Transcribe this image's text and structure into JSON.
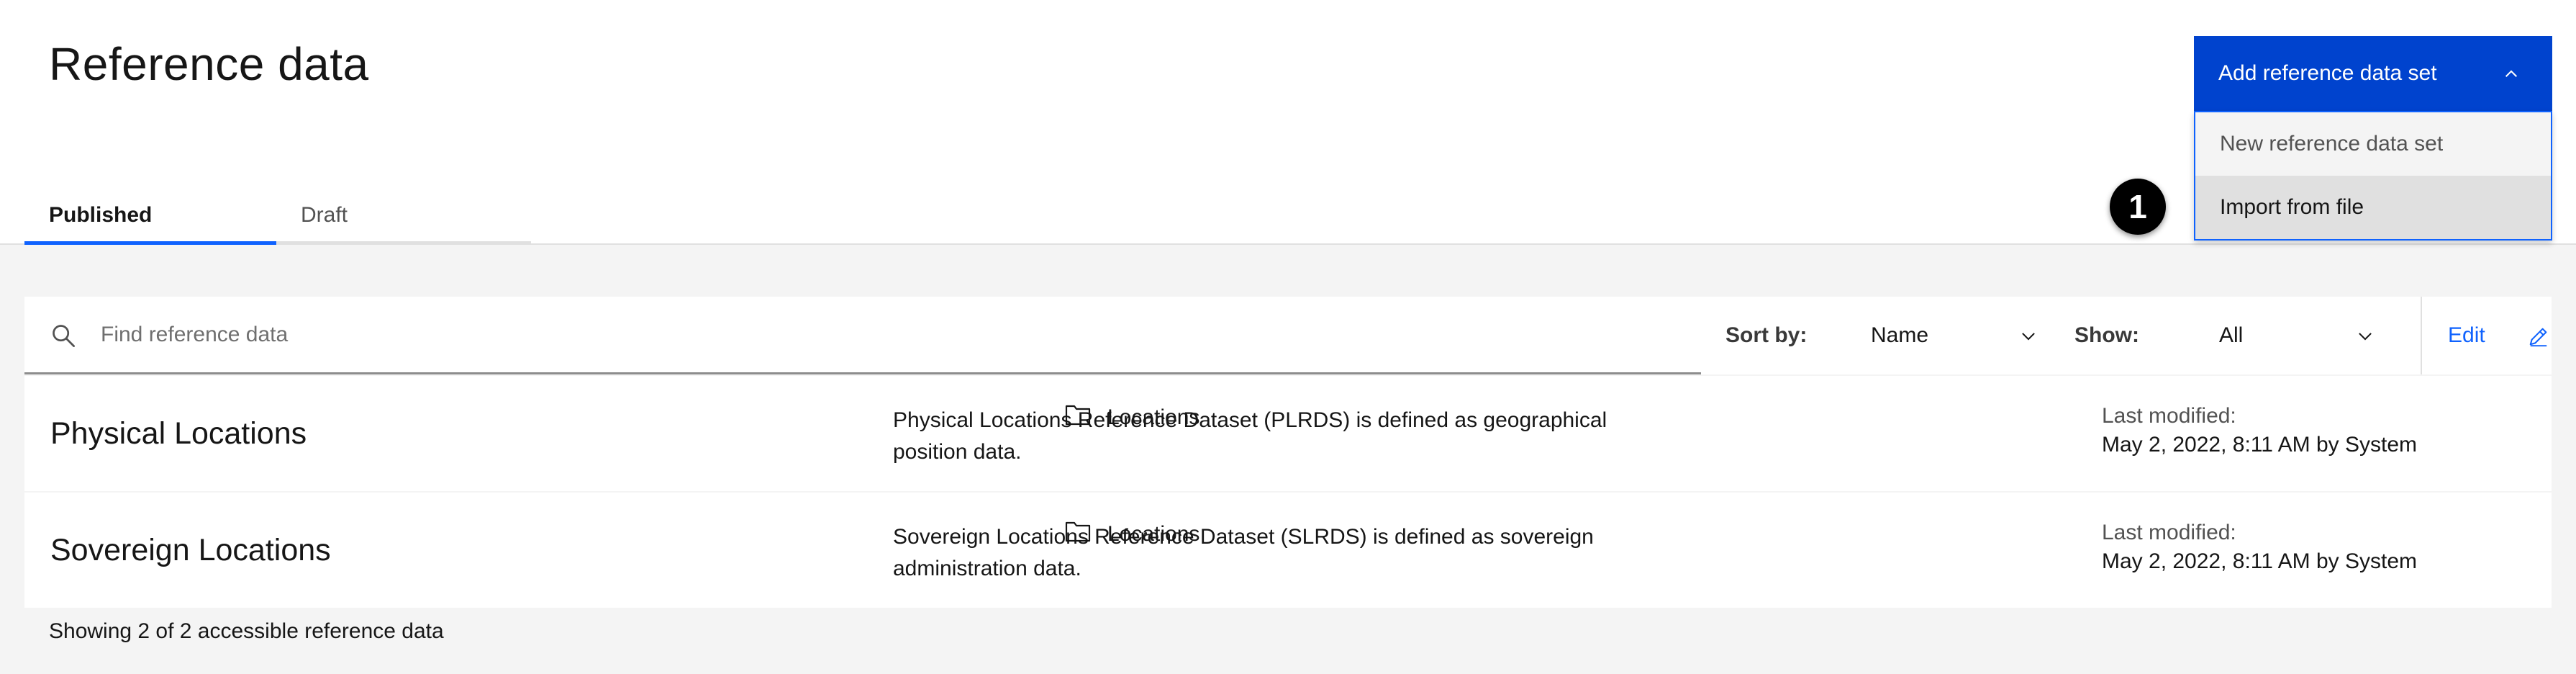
{
  "header": {
    "title": "Reference data",
    "tabs": [
      {
        "label": "Published",
        "active": true
      },
      {
        "label": "Draft",
        "active": false
      }
    ]
  },
  "add_button": {
    "label": "Add reference data set",
    "icon": "chevron-up-icon",
    "menu": [
      {
        "label": "New reference data set"
      },
      {
        "label": "Import from file"
      }
    ]
  },
  "callout_badge": "1",
  "toolbar": {
    "search": {
      "placeholder": "Find reference data",
      "value": "",
      "icon": "search-icon"
    },
    "sort": {
      "label": "Sort by:",
      "value": "Name"
    },
    "show": {
      "label": "Show:",
      "value": "All"
    },
    "edit": {
      "label": "Edit",
      "icon": "pencil-icon"
    }
  },
  "rows": [
    {
      "name": "Physical Locations",
      "description": "Physical Locations Reference Dataset (PLRDS) is defined as geographical position data.",
      "folder": "Locations",
      "modified_label": "Last modified:",
      "modified_value": "May 2, 2022, 8:11 AM by System"
    },
    {
      "name": "Sovereign Locations",
      "description": "Sovereign Locations Reference Dataset (SLRDS) is defined as sovereign administration data.",
      "folder": "Locations",
      "modified_label": "Last modified:",
      "modified_value": "May 2, 2022, 8:11 AM by System"
    }
  ],
  "footer": {
    "text": "Showing 2 of 2 accessible reference data"
  },
  "colors": {
    "accent": "#0f62fe",
    "button": "#0043ce",
    "background": "#f4f4f4"
  }
}
